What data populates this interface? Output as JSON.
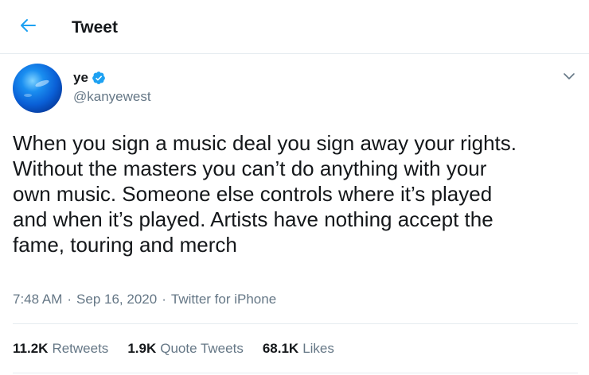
{
  "header": {
    "title": "Tweet",
    "back_icon": "arrow-left-icon",
    "accent": "#1da1f2"
  },
  "author": {
    "display_name": "ye",
    "handle": "@kanyewest",
    "verified": true,
    "verified_color": "#1da1f2"
  },
  "tweet": {
    "text": "When you sign a music deal you sign away your rights.\nWithout the masters you can’t do anything with your\nown music. Someone else controls where it’s played\nand when it’s played. Artists have nothing accept the\nfame, touring and merch",
    "time": "7:48 AM",
    "separator": "·",
    "date": "Sep 16, 2020",
    "source": "Twitter for iPhone"
  },
  "stats": [
    {
      "count": "11.2K",
      "label": "Retweets"
    },
    {
      "count": "1.9K",
      "label": "Quote Tweets"
    },
    {
      "count": "68.1K",
      "label": "Likes"
    }
  ]
}
